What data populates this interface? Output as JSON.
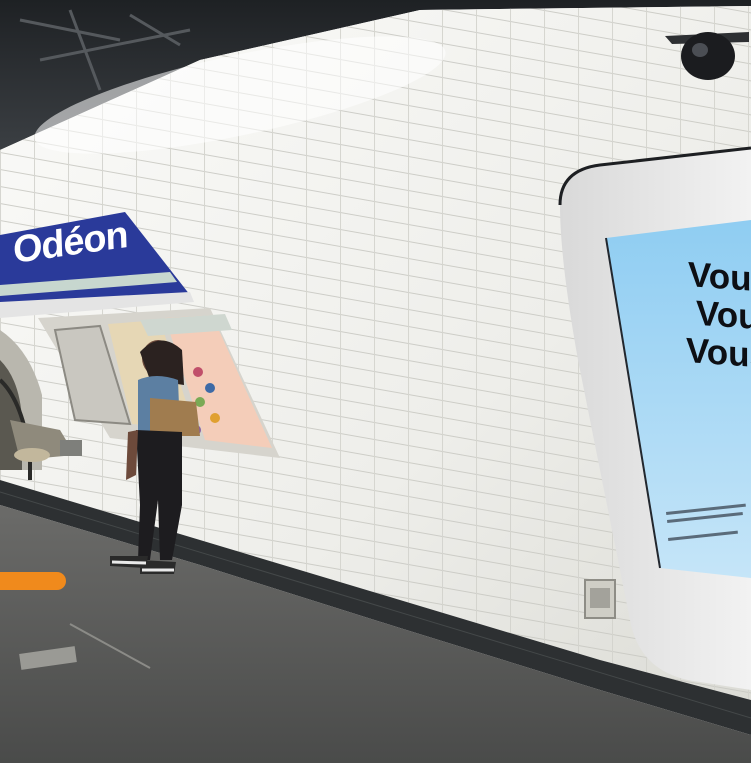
{
  "scene": {
    "description_free": true,
    "station_sign": {
      "name": "Odéon",
      "color": "#2a3a9a"
    },
    "screen": {
      "lines": [
        "Vous",
        "Vou",
        "Vous"
      ],
      "background": "#a9d7f5"
    },
    "accent_bar_color": "#f08a1c"
  }
}
